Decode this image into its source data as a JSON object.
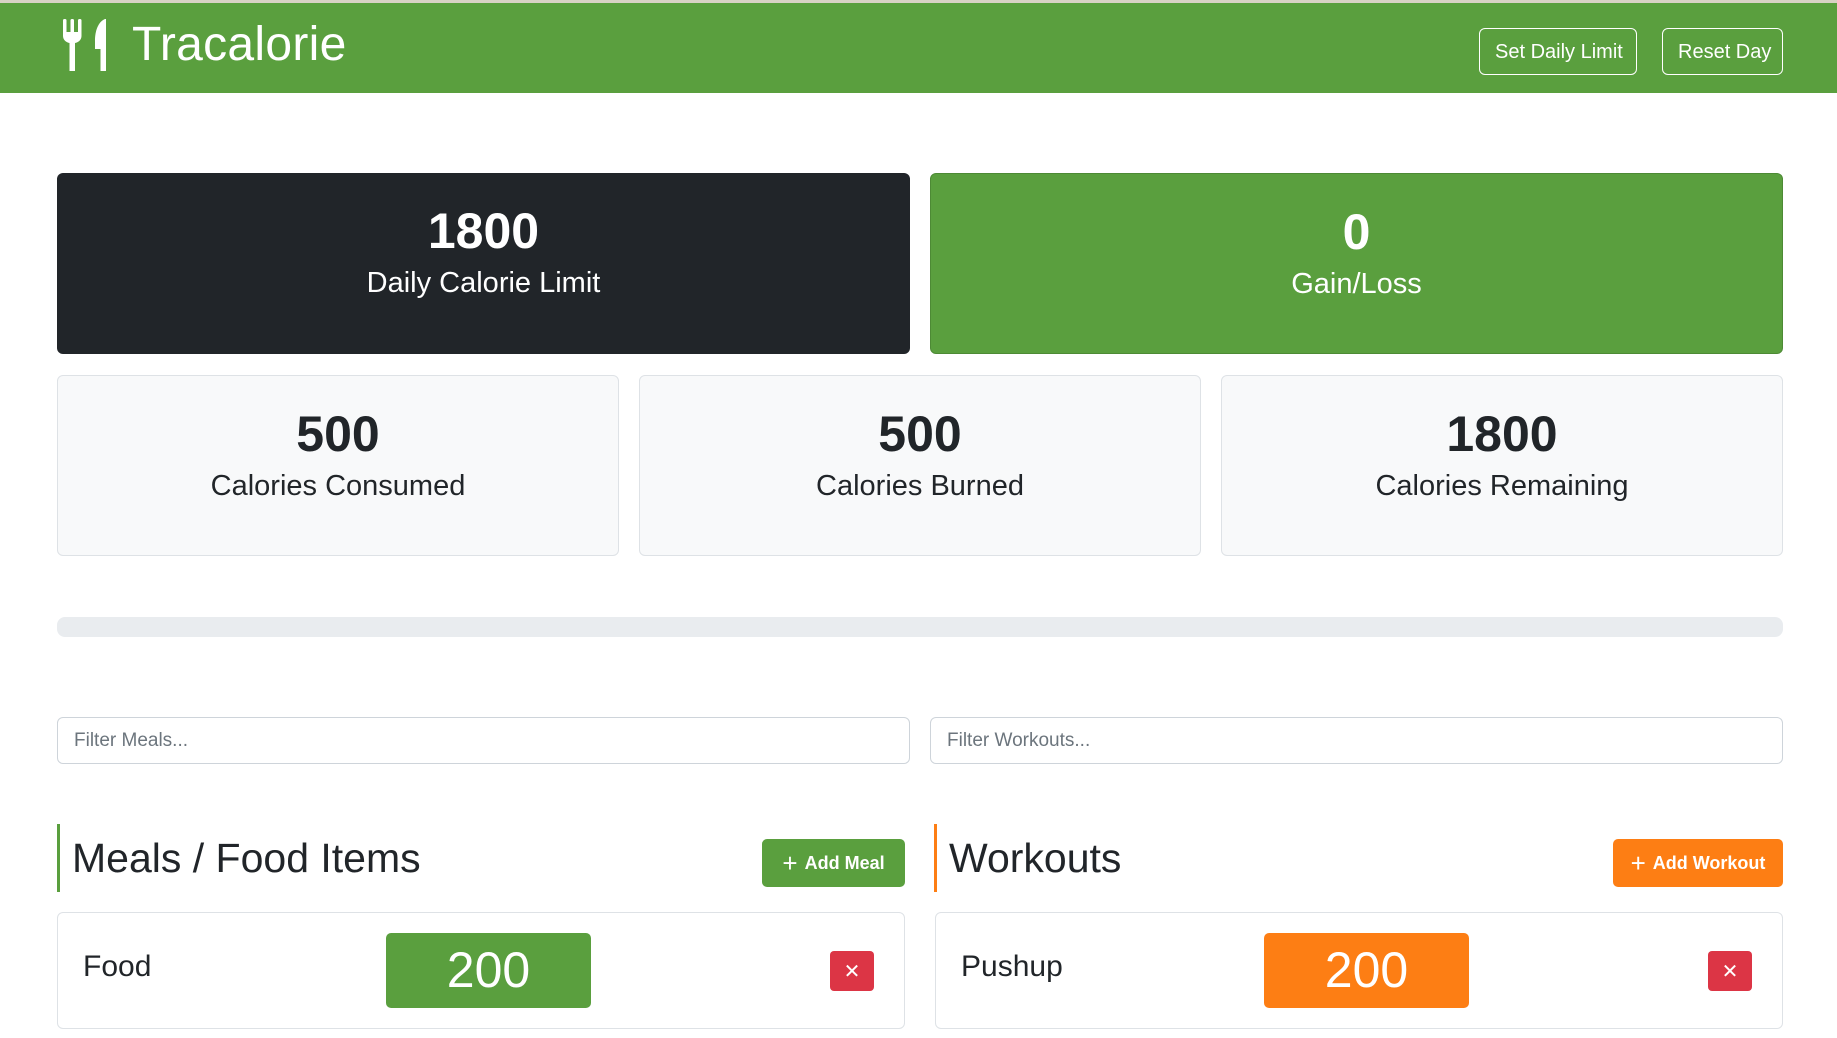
{
  "app": {
    "title": "Tracalorie"
  },
  "navbar": {
    "brand_icon": "utensils-icon",
    "set_limit_label": "Set Daily Limit",
    "reset_label": "Reset Day"
  },
  "stats": {
    "limit": {
      "value": "1800",
      "label": "Daily Calorie Limit"
    },
    "gain_loss": {
      "value": "0",
      "label": "Gain/Loss"
    },
    "consumed": {
      "value": "500",
      "label": "Calories Consumed"
    },
    "burned": {
      "value": "500",
      "label": "Calories Burned"
    },
    "remaining": {
      "value": "1800",
      "label": "Calories Remaining"
    }
  },
  "progress": {
    "value_percent": 0
  },
  "filters": {
    "meals_placeholder": "Filter Meals...",
    "workouts_placeholder": "Filter Workouts..."
  },
  "meals": {
    "title": "Meals / Food Items",
    "add_label": "Add Meal",
    "items": [
      {
        "name": "Food",
        "calories": "200"
      }
    ]
  },
  "workouts": {
    "title": "Workouts",
    "add_label": "Add Workout",
    "items": [
      {
        "name": "Pushup",
        "calories": "200"
      }
    ]
  },
  "icons": {
    "add": "plus-icon",
    "delete": "close-icon"
  },
  "colors": {
    "primary_green": "#5a9f3e",
    "dark": "#212529",
    "light_card": "#f8f9fa",
    "workout_orange": "#fd7e14",
    "danger_red": "#dc3545",
    "progress_track": "#e9ecef"
  }
}
